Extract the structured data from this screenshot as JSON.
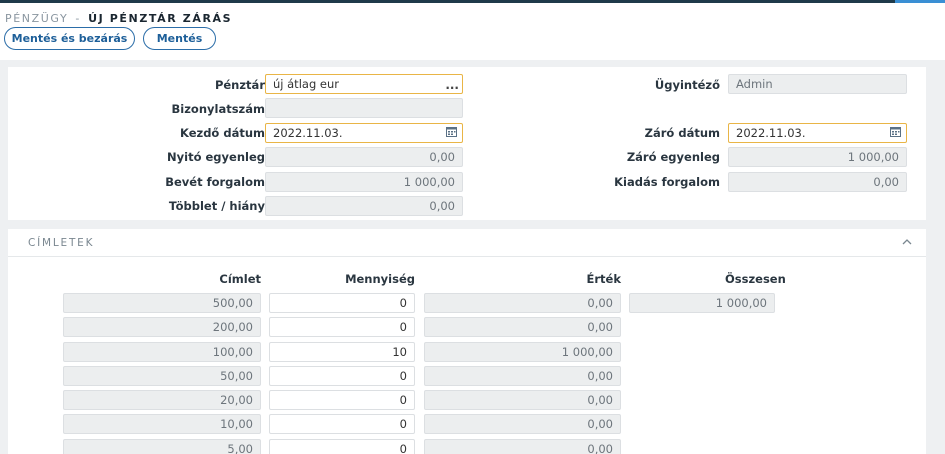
{
  "header": {
    "crumb": "PÉNZÜGY",
    "separator": "-",
    "page_title": "ÚJ PÉNZTÁR ZÁRÁS",
    "save_close_label": "Mentés és bezárás",
    "save_label": "Mentés"
  },
  "form": {
    "penztar": {
      "label": "Pénztár",
      "value": "új átlag eur"
    },
    "bizonylatszam": {
      "label": "Bizonylatszám",
      "value": ""
    },
    "kezdo_datum": {
      "label": "Kezdő dátum",
      "value": "2022.11.03."
    },
    "nyito_egyenleg": {
      "label": "Nyitó egyenleg",
      "value": "0,00"
    },
    "bevet_forgalom": {
      "label": "Bevét forgalom",
      "value": "1 000,00"
    },
    "tobblet_hiany": {
      "label": "Többlet / hiány",
      "value": "0,00"
    },
    "ugyintezo": {
      "label": "Ügyintéző",
      "value": "Admin"
    },
    "zaro_datum": {
      "label": "Záró dátum",
      "value": "2022.11.03."
    },
    "zaro_egyenleg": {
      "label": "Záró egyenleg",
      "value": "1 000,00"
    },
    "kiadas_forgalom": {
      "label": "Kiadás forgalom",
      "value": "0,00"
    }
  },
  "cimletek": {
    "title": "CÍMLETEK",
    "headers": {
      "cimlet": "Címlet",
      "mennyiseg": "Mennyiség",
      "ertek": "Érték",
      "osszesen": "Összesen"
    },
    "total": "1 000,00",
    "rows": [
      {
        "cimlet": "500,00",
        "mennyiseg": "0",
        "ertek": "0,00"
      },
      {
        "cimlet": "200,00",
        "mennyiseg": "0",
        "ertek": "0,00"
      },
      {
        "cimlet": "100,00",
        "mennyiseg": "10",
        "ertek": "1 000,00"
      },
      {
        "cimlet": "50,00",
        "mennyiseg": "0",
        "ertek": "0,00"
      },
      {
        "cimlet": "20,00",
        "mennyiseg": "0",
        "ertek": "0,00"
      },
      {
        "cimlet": "10,00",
        "mennyiseg": "0",
        "ertek": "0,00"
      },
      {
        "cimlet": "5,00",
        "mennyiseg": "0",
        "ertek": "0,00"
      }
    ]
  },
  "icons": {
    "calendar": "calendar-icon",
    "ellipsis": "more-options-icon",
    "collapse": "chevron-up-icon"
  },
  "colors": {
    "accent": "#2b6da8",
    "edit_border": "#e9b546",
    "topbar": "#1f3a4a"
  }
}
